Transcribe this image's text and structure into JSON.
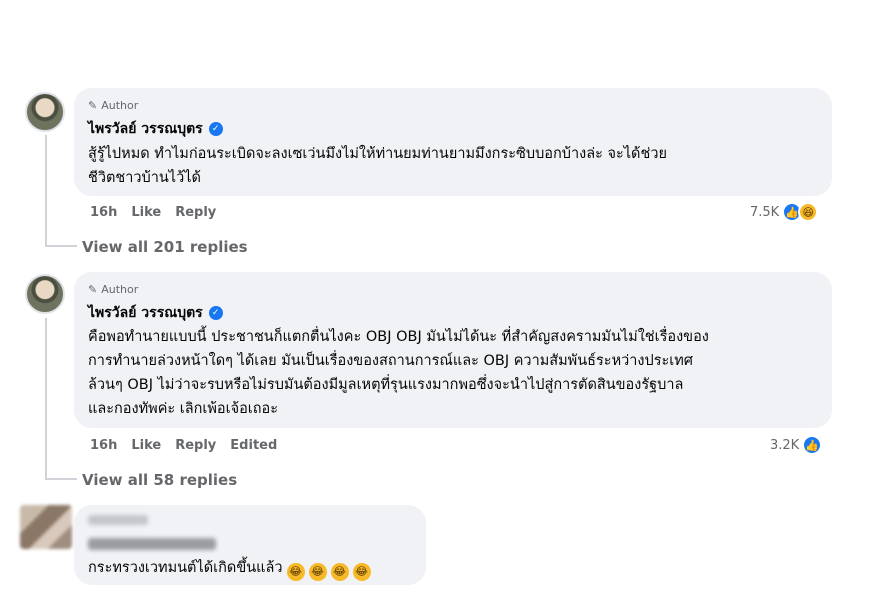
{
  "comments": [
    {
      "badge": "Author",
      "name": "ไพรวัลย์ วรรณบุตร",
      "lines": [
        "สู้รู้ไปหมด ทำไมก่อนระเบิดจะลงเซเว่นมึงไม่ให้ท่านยมท่านยามมึงกระซิบบอกบ้างล่ะ จะได้ช่วย",
        "ชีวิตชาวบ้านไว้ได้"
      ],
      "time": "16h",
      "like": "Like",
      "reply": "Reply",
      "reaction_count": "7.5K",
      "view_replies": "View all 201 replies"
    },
    {
      "badge": "Author",
      "name": "ไพรวัลย์ วรรณบุตร",
      "lines": [
        "คือพอทำนายแบบนี้ ประชาชนก็แตกตื่นไงคะ OBJ OBJ มันไม่ได้นะ ที่สำคัญสงครามมันไม่ใช่เรื่องของ",
        "การทำนายล่วงหน้าใดๆ ได้เลย มันเป็นเรื่องของสถานการณ์และ OBJ ความสัมพันธ์ระหว่างประเทศ",
        "ล้วนๆ OBJ ไม่ว่าจะรบหรือไม่รบมันต้องมีมูลเหตุที่รุนแรงมากพอซึ่งจะนำไปสู่การตัดสินของรัฐบาล",
        "และกองทัพค่ะ เลิกเพ้อเจ้อเถอะ"
      ],
      "time": "16h",
      "like": "Like",
      "reply": "Reply",
      "edited": "Edited",
      "reaction_count": "3.2K",
      "view_replies": "View all 58 replies"
    },
    {
      "text": "กระทรวงเวทมนต์ได้เกิดขึ้นแล้ว"
    }
  ],
  "icons": {
    "pencil": "pencil-icon",
    "verified": "verified-badge-icon",
    "like": "like-reaction-icon",
    "haha": "haha-reaction-icon"
  },
  "colors": {
    "bubble": "#f0f2f5",
    "accent": "#1877f2",
    "muted": "#65676b"
  }
}
